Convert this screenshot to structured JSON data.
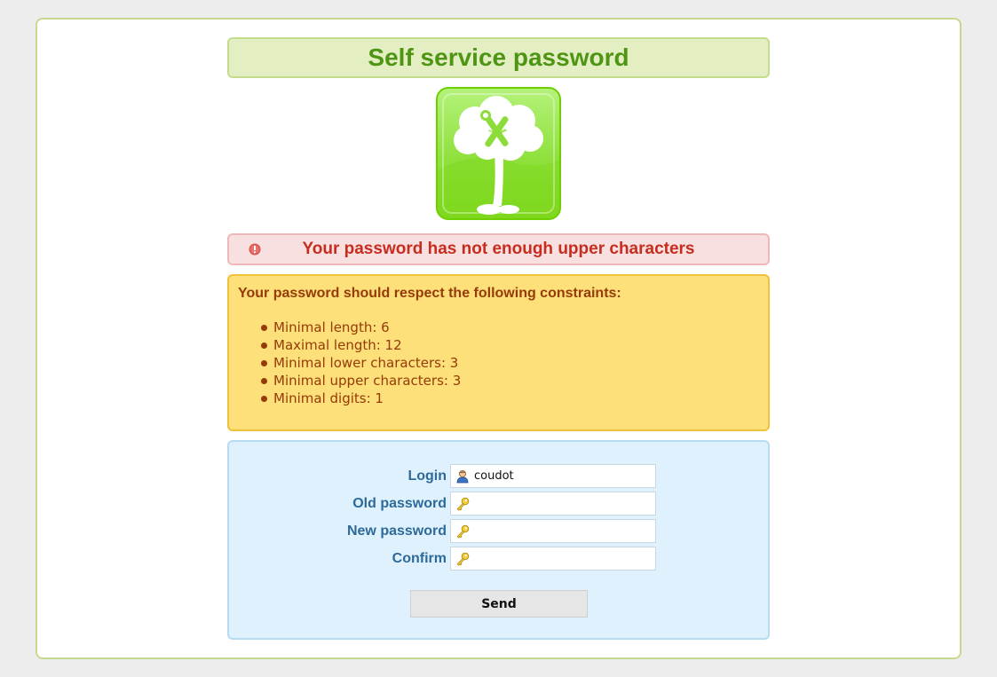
{
  "page": {
    "title": "Self service password"
  },
  "logo": {
    "icon": "tree-wrench-logo-icon"
  },
  "error": {
    "icon": "alert-icon",
    "message": "Your password has not enough upper characters"
  },
  "constraints": {
    "title": "Your password should respect the following constraints:",
    "items": [
      "Minimal length: 6",
      "Maximal length: 12",
      "Minimal lower characters: 3",
      "Minimal upper characters: 3",
      "Minimal digits: 1"
    ]
  },
  "form": {
    "login": {
      "label": "Login",
      "value": "coudot",
      "icon": "user-icon"
    },
    "old_password": {
      "label": "Old password",
      "value": "",
      "icon": "key-icon"
    },
    "new_password": {
      "label": "New password",
      "value": "",
      "icon": "key-icon"
    },
    "confirm": {
      "label": "Confirm",
      "value": "",
      "icon": "key-icon"
    },
    "send_label": "Send"
  },
  "colors": {
    "title_green": "#4f9514",
    "error_red": "#c62d1f",
    "warning_brown": "#963a08",
    "label_blue": "#2d6a9a"
  }
}
